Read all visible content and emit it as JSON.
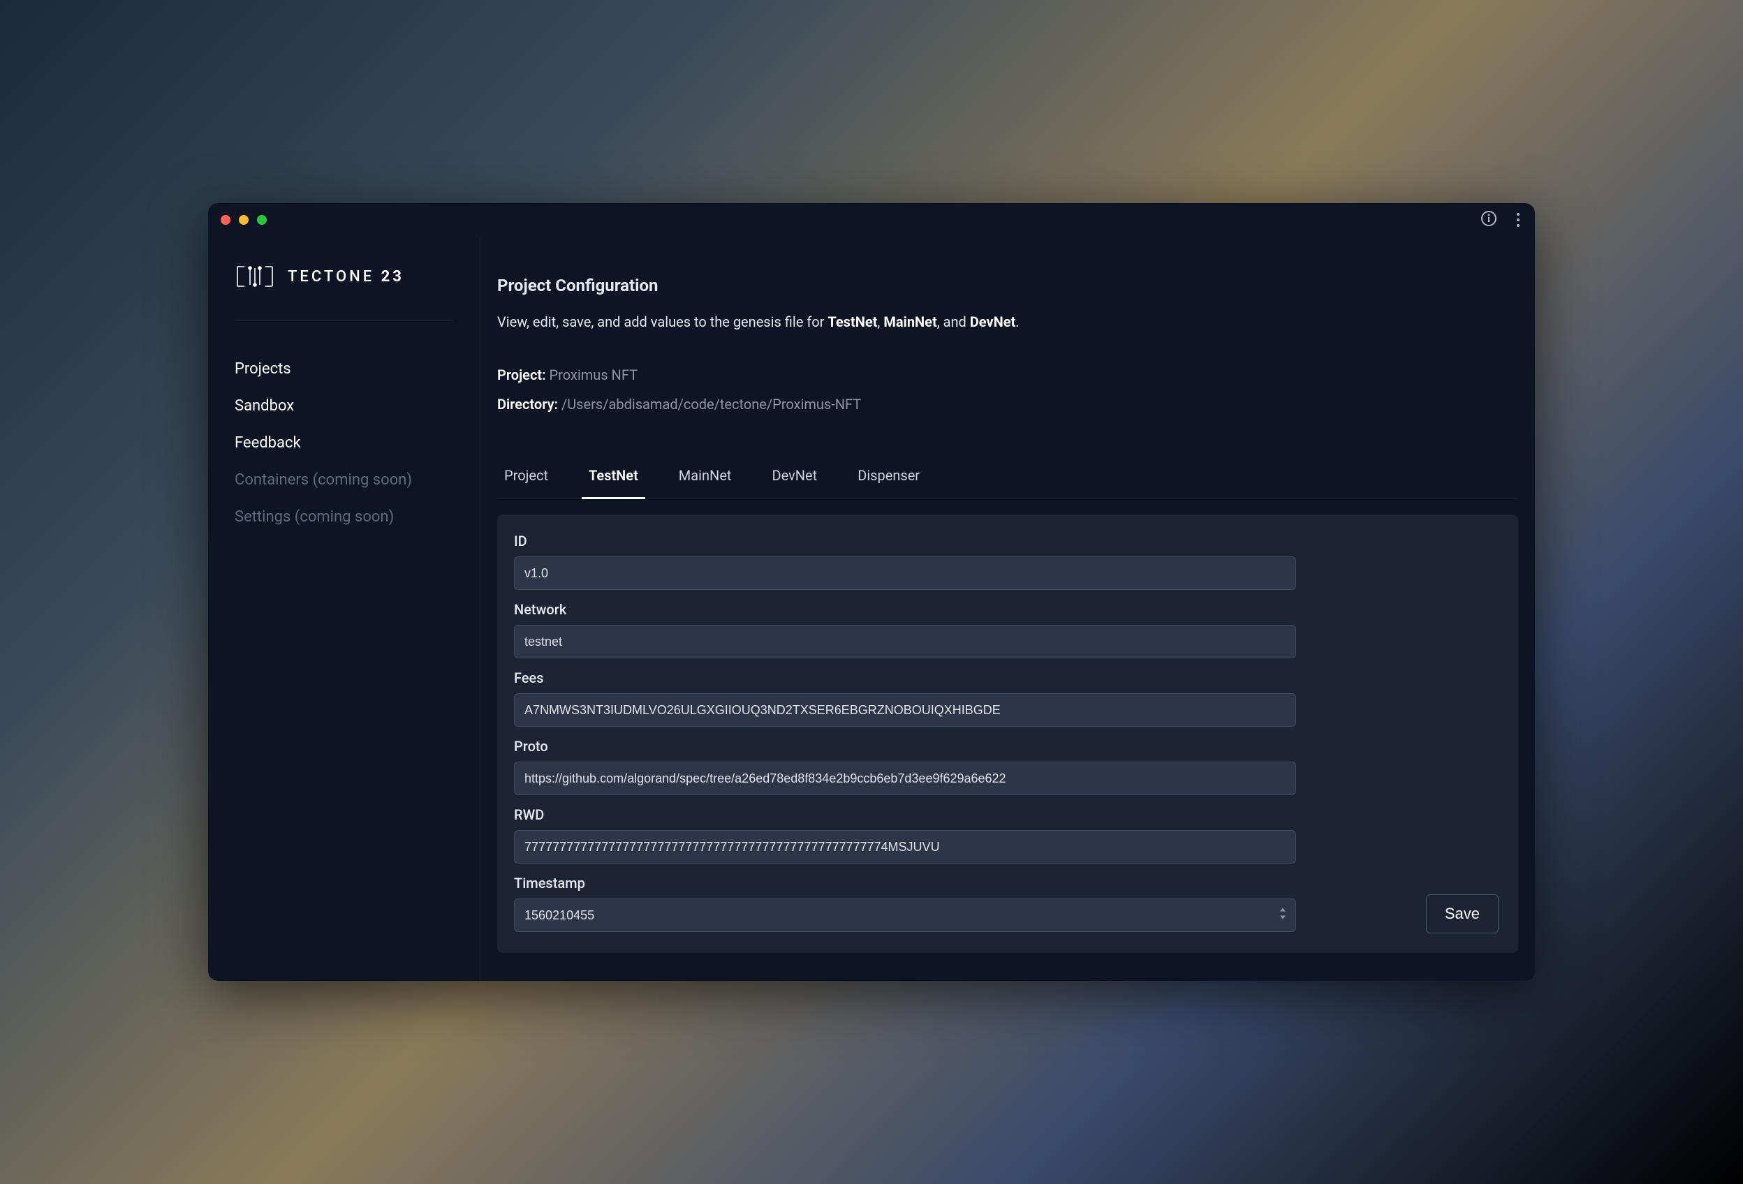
{
  "brand": {
    "name": "TECTONE",
    "suffix": "23"
  },
  "sidebar": {
    "items": [
      {
        "label": "Projects",
        "disabled": false
      },
      {
        "label": "Sandbox",
        "disabled": false
      },
      {
        "label": "Feedback",
        "disabled": false
      },
      {
        "label": "Containers (coming soon)",
        "disabled": true
      },
      {
        "label": "Settings (coming soon)",
        "disabled": true
      }
    ]
  },
  "page": {
    "title": "Project Configuration",
    "subtitle_prefix": "View, edit, save, and add values to the genesis file for ",
    "subtitle_net1": "TestNet",
    "subtitle_sep1": ", ",
    "subtitle_net2": "MainNet",
    "subtitle_sep2": ", and ",
    "subtitle_net3": "DevNet",
    "subtitle_suffix": "."
  },
  "project": {
    "label": "Project:",
    "value": "Proximus NFT",
    "dir_label": "Directory:",
    "dir_value": "/Users/abdisamad/code/tectone/Proximus-NFT"
  },
  "tabs": [
    {
      "label": "Project",
      "active": false
    },
    {
      "label": "TestNet",
      "active": true
    },
    {
      "label": "MainNet",
      "active": false
    },
    {
      "label": "DevNet",
      "active": false
    },
    {
      "label": "Dispenser",
      "active": false
    }
  ],
  "form": {
    "id_label": "ID",
    "id_value": "v1.0",
    "network_label": "Network",
    "network_value": "testnet",
    "fees_label": "Fees",
    "fees_value": "A7NMWS3NT3IUDMLVO26ULGXGIIOUQ3ND2TXSER6EBGRZNOBOUIQXHIBGDE",
    "proto_label": "Proto",
    "proto_value": "https://github.com/algorand/spec/tree/a26ed78ed8f834e2b9ccb6eb7d3ee9f629a6e622",
    "rwd_label": "RWD",
    "rwd_value": "7777777777777777777777777777777777777777777777777774MSJUVU",
    "timestamp_label": "Timestamp",
    "timestamp_value": "1560210455"
  },
  "actions": {
    "save": "Save"
  }
}
